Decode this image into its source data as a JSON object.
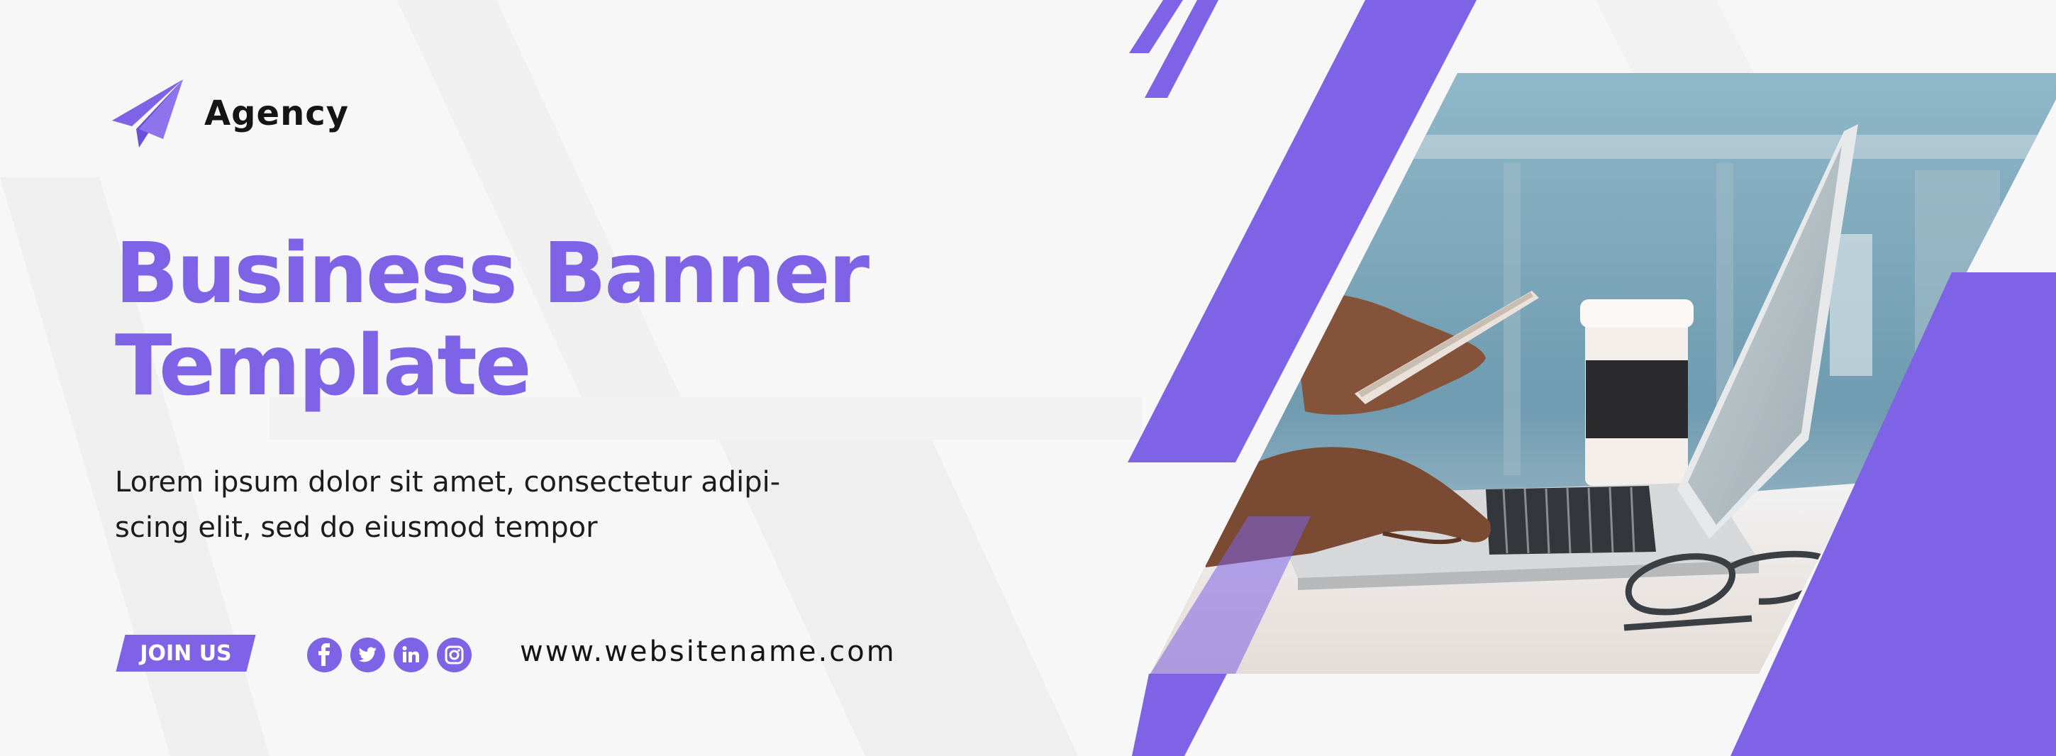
{
  "brand": {
    "name": "Agency",
    "logo_icon": "paper-plane-icon"
  },
  "headline": {
    "line1": "Business Banner",
    "line2": "Template"
  },
  "body": {
    "line1": "Lorem ipsum dolor sit amet, consectetur adipi-",
    "line2": "scing elit, sed do eiusmod tempor"
  },
  "cta": {
    "join_label": "JOIN US"
  },
  "social": [
    {
      "icon": "facebook-icon"
    },
    {
      "icon": "twitter-icon"
    },
    {
      "icon": "linkedin-icon"
    },
    {
      "icon": "instagram-icon"
    }
  ],
  "website": "www.websitename.com",
  "photo": {
    "subject": "laptop-coffee-phone-photo"
  },
  "colors": {
    "accent": "#7e63e6",
    "text_dark": "#151515",
    "background": "#f7f7f8"
  }
}
